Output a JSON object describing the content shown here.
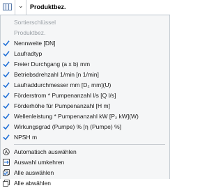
{
  "header": {
    "column_title": "Produktbez."
  },
  "menu": {
    "columns": [
      {
        "label": "Sortierschlüssel",
        "checked": false,
        "enabled": false
      },
      {
        "label": "Produktbez.",
        "checked": false,
        "enabled": false
      },
      {
        "label": "Nennweite [DN]",
        "checked": true,
        "enabled": true
      },
      {
        "label": "Laufradtyp",
        "checked": true,
        "enabled": true
      },
      {
        "label": "Freier Durchgang (a x b) mm",
        "checked": true,
        "enabled": true
      },
      {
        "label": "Betriebsdrehzahl 1/min [n 1/min]",
        "checked": true,
        "enabled": true
      },
      {
        "label": "Laufraddurchmesser mm [D₂ mm](U)",
        "checked": true,
        "enabled": true
      },
      {
        "label": "Förderstrom * Pumpenanzahl l/s [Q l/s]",
        "checked": true,
        "enabled": true
      },
      {
        "label": "Förderhöhe für Pumpenanzahl [H m]",
        "checked": true,
        "enabled": true
      },
      {
        "label": "Wellenleistung * Pumpenanzahl kW [P₂ kW](W)",
        "checked": true,
        "enabled": true
      },
      {
        "label": "Wirkungsgrad (Pumpe) % [η (Pumpe) %]",
        "checked": true,
        "enabled": true
      },
      {
        "label": "NPSH m",
        "checked": true,
        "enabled": true
      }
    ],
    "actions": [
      {
        "label": "Automatisch auswählen",
        "icon": "auto-select-icon"
      },
      {
        "label": "Auswahl umkehren",
        "icon": "invert-selection-icon"
      },
      {
        "label": "Alle auswählen",
        "icon": "select-all-icon"
      },
      {
        "label": "Alle abwählen",
        "icon": "deselect-all-icon"
      }
    ]
  },
  "colors": {
    "check": "#1f6fd6",
    "disabled_text": "#9aa0a6",
    "menu_bg": "#f5f6f7"
  }
}
